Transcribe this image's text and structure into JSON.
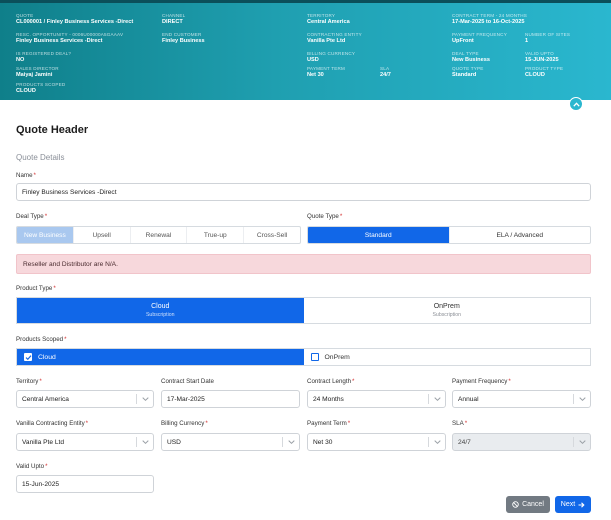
{
  "header": {
    "columns": [
      [
        {
          "label": "QUOTE",
          "value": "CL000001 / Finley Business Services -Direct"
        },
        {
          "label": "RESC. OPPORTUNITY - 0006U00000A5GAAAV",
          "value": "Finley Business Services -Direct"
        },
        {
          "label": "IS REGISTERED DEAL?",
          "value": "NO"
        },
        {
          "label": "SALES DIRECTOR",
          "value": "Maiyaj Jamini"
        },
        {
          "label": "PRODUCTS SCOPED",
          "value": "CLOUD"
        }
      ],
      [
        {
          "label": "CHANNEL",
          "value": "DIRECT"
        },
        {
          "label": "END CUSTOMER",
          "value": "Finley Business"
        }
      ],
      [
        {
          "label": "TERRITORY",
          "value": "Central America"
        },
        {
          "label": "CONTRACTING ENTITY",
          "value": "Vanilla Pte Ltd"
        },
        {
          "label": "BILLING CURRENCY",
          "value": "USD"
        },
        {
          "label": "PAYMENT TERM",
          "value": "Net 30"
        }
      ],
      [
        {
          "label": "SLA",
          "value": "24/7"
        }
      ],
      [
        {
          "label": "CONTRACT TERM - 24 MONTHS",
          "value": "17-Mar-2025 to 16-Oct-2025"
        },
        {
          "label": "PAYMENT FREQUENCY",
          "value": "UpFront"
        },
        {
          "label": "DEAL TYPE",
          "value": "New Business"
        },
        {
          "label": "QUOTE TYPE",
          "value": "Standard"
        }
      ],
      [
        {
          "label": "NUMBER OF SITES",
          "value": "1"
        },
        {
          "label": "VALID UPTO",
          "value": "15-JUN-2025"
        },
        {
          "label": "PRODUCT TYPE",
          "value": "CLOUD"
        }
      ]
    ]
  },
  "page": {
    "title": "Quote Header",
    "section": "Quote Details"
  },
  "form": {
    "name_label": "Name",
    "name_value": "Finley Business Services -Direct",
    "deal_type_label": "Deal Type",
    "deal_types": [
      "New Business",
      "Upsell",
      "Renewal",
      "True-up",
      "Cross-Sell"
    ],
    "quote_type_label": "Quote Type",
    "quote_types": [
      "Standard",
      "ELA / Advanced"
    ],
    "alert": "Reseller and Distributor are N/A.",
    "product_type_label": "Product Type",
    "product_types": [
      {
        "name": "Cloud",
        "sub": "Subscription"
      },
      {
        "name": "OnPrem",
        "sub": "Subscription"
      }
    ],
    "products_scoped_label": "Products Scoped",
    "products_scoped": [
      "Cloud",
      "OnPrem"
    ],
    "territory_label": "Territory",
    "territory_value": "Central America",
    "contract_start_label": "Contract Start Date",
    "contract_start_value": "17-Mar-2025",
    "contract_length_label": "Contract Length",
    "contract_length_value": "24 Months",
    "payment_frequency_label": "Payment Frequency",
    "payment_frequency_value": "Annual",
    "vanilla_entity_label": "Vanilla Contracting Entity",
    "vanilla_entity_value": "Vanilla Pte Ltd",
    "billing_currency_label": "Billing Currency",
    "billing_currency_value": "USD",
    "payment_term_label": "Payment Term",
    "payment_term_value": "Net 30",
    "sla_label": "SLA",
    "sla_value": "24/7",
    "valid_upto_label": "Valid Upto",
    "valid_upto_value": "15-Jun-2025"
  },
  "actions": {
    "cancel": "Cancel",
    "next": "Next"
  },
  "colors": {
    "accent": "#1167e8",
    "banner_start": "#0f7f8a",
    "banner_end": "#2ab7cf",
    "alert_bg": "#f7d8dc"
  }
}
